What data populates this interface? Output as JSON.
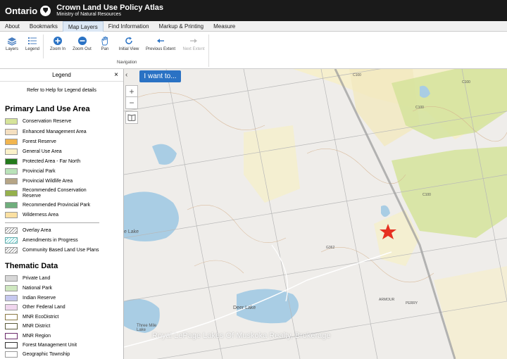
{
  "header": {
    "brand": "Ontario",
    "title": "Crown Land Use Policy Atlas",
    "subtitle": "Ministry of Natural Resources"
  },
  "tabs": [
    "About",
    "Bookmarks",
    "Map Layers",
    "Find Information",
    "Markup & Printing",
    "Measure"
  ],
  "active_tab": "Map Layers",
  "toolbar": {
    "layers": "Layers",
    "legend": "Legend",
    "zoom_in": "Zoom In",
    "zoom_out": "Zoom Out",
    "pan": "Pan",
    "initial_view": "Initial View",
    "previous_extent": "Previous Extent",
    "next_extent": "Next Extent",
    "navigation": "Navigation"
  },
  "legend": {
    "title": "Legend",
    "close": "×",
    "help": "Refer to Help for Legend details",
    "primary_title": "Primary Land Use Area",
    "primary_items": [
      {
        "label": "Conservation Reserve",
        "color": "#d6e49a"
      },
      {
        "label": "Enhanced Management Area",
        "color": "#f4dfc0"
      },
      {
        "label": "Forest Reserve",
        "color": "#f1b54f"
      },
      {
        "label": "General Use Area",
        "color": "#fbf1c9"
      },
      {
        "label": "Protected Area - Far North",
        "color": "#237a1c"
      },
      {
        "label": "Provincial Park",
        "color": "#b9e3b9"
      },
      {
        "label": "Provincial Wildlife Area",
        "color": "#b6a586"
      },
      {
        "label": "Recommended Conservation Reserve",
        "color": "#95b14c"
      },
      {
        "label": "Recommended Provincial Park",
        "color": "#6fae7c"
      },
      {
        "label": "Wilderness Area",
        "color": "#fbe0a2"
      }
    ],
    "overlay_items": [
      {
        "label": "Overlay Area",
        "style": "hatch"
      },
      {
        "label": "Amendments in Progress",
        "style": "hatch-cyan"
      },
      {
        "label": "Community Based Land Use Plans",
        "style": "hatch"
      }
    ],
    "thematic_title": "Thematic Data",
    "thematic_items": [
      {
        "label": "Private Land",
        "color": "#d7d7d7",
        "border": "#999"
      },
      {
        "label": "National Park",
        "color": "#cfe8c0",
        "border": "#999"
      },
      {
        "label": "Indian Reserve",
        "color": "#c6c8ef",
        "border": "#999"
      },
      {
        "label": "Other Federal Land",
        "color": "#f0d6ee",
        "border": "#999"
      },
      {
        "label": "MNR EcoDistrict",
        "color": "#ffffff",
        "border": "#8a7a44"
      },
      {
        "label": "MNR District",
        "color": "#ffffff",
        "border": "#5a5a3a"
      },
      {
        "label": "MNR Region",
        "color": "#ffffff",
        "border": "#6a2a6a"
      },
      {
        "label": "Forest Management Unit",
        "color": "#ffffff",
        "border": "#333"
      },
      {
        "label": "Geographic Township",
        "color": "#ffffff",
        "border": "#999"
      }
    ]
  },
  "map": {
    "i_want_to": "I want to...",
    "zoom_in": "+",
    "zoom_out": "−",
    "collapse": "‹",
    "labels": {
      "c100_a": "C100",
      "c100_b": "C100",
      "c100_c": "C100",
      "c100_d": "C100",
      "g362": "G362",
      "deer_lake": "Deer Lake",
      "three_mile": "Three Mile Lake",
      "lake": "e Lake",
      "armour": "ARMOUR",
      "perry": "PERRY"
    },
    "watermark": "Royal LePage Lakes Of Muskoka Realty, Brokerage"
  }
}
